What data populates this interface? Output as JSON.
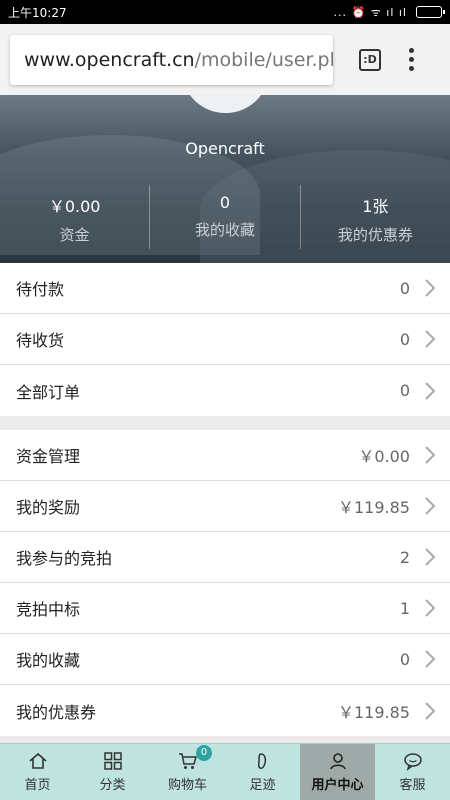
{
  "status_bar": {
    "time": "上午10:27",
    "icons": "... ⏰ ᯤ ıl ıl"
  },
  "browser": {
    "url_host": "www.opencraft.cn",
    "url_path": "/mobile/user.ph",
    "tab_label": ":D"
  },
  "profile": {
    "username": "Opencraft"
  },
  "stats": [
    {
      "value": "￥0.00",
      "label": "资金"
    },
    {
      "value": "0",
      "label": "我的收藏"
    },
    {
      "value": "1张",
      "label": "我的优惠券"
    }
  ],
  "orders": [
    {
      "label": "待付款",
      "value": "0"
    },
    {
      "label": "待收货",
      "value": "0"
    },
    {
      "label": "全部订单",
      "value": "0"
    }
  ],
  "account": [
    {
      "label": "资金管理",
      "value": "￥0.00"
    },
    {
      "label": "我的奖励",
      "value": "￥119.85"
    },
    {
      "label": "我参与的竞拍",
      "value": "2"
    },
    {
      "label": "竞拍中标",
      "value": "1"
    },
    {
      "label": "我的收藏",
      "value": "0"
    },
    {
      "label": "我的优惠券",
      "value": "￥119.85"
    }
  ],
  "tabbar": {
    "home": "首页",
    "category": "分类",
    "cart": "购物车",
    "cart_count": "0",
    "footprint": "足迹",
    "user_center": "用户中心",
    "service": "客服"
  },
  "colors": {
    "tabbar_bg": "#bfe3df",
    "tab_active_bg": "#9fa9a8",
    "badge": "#2fa3a0"
  }
}
